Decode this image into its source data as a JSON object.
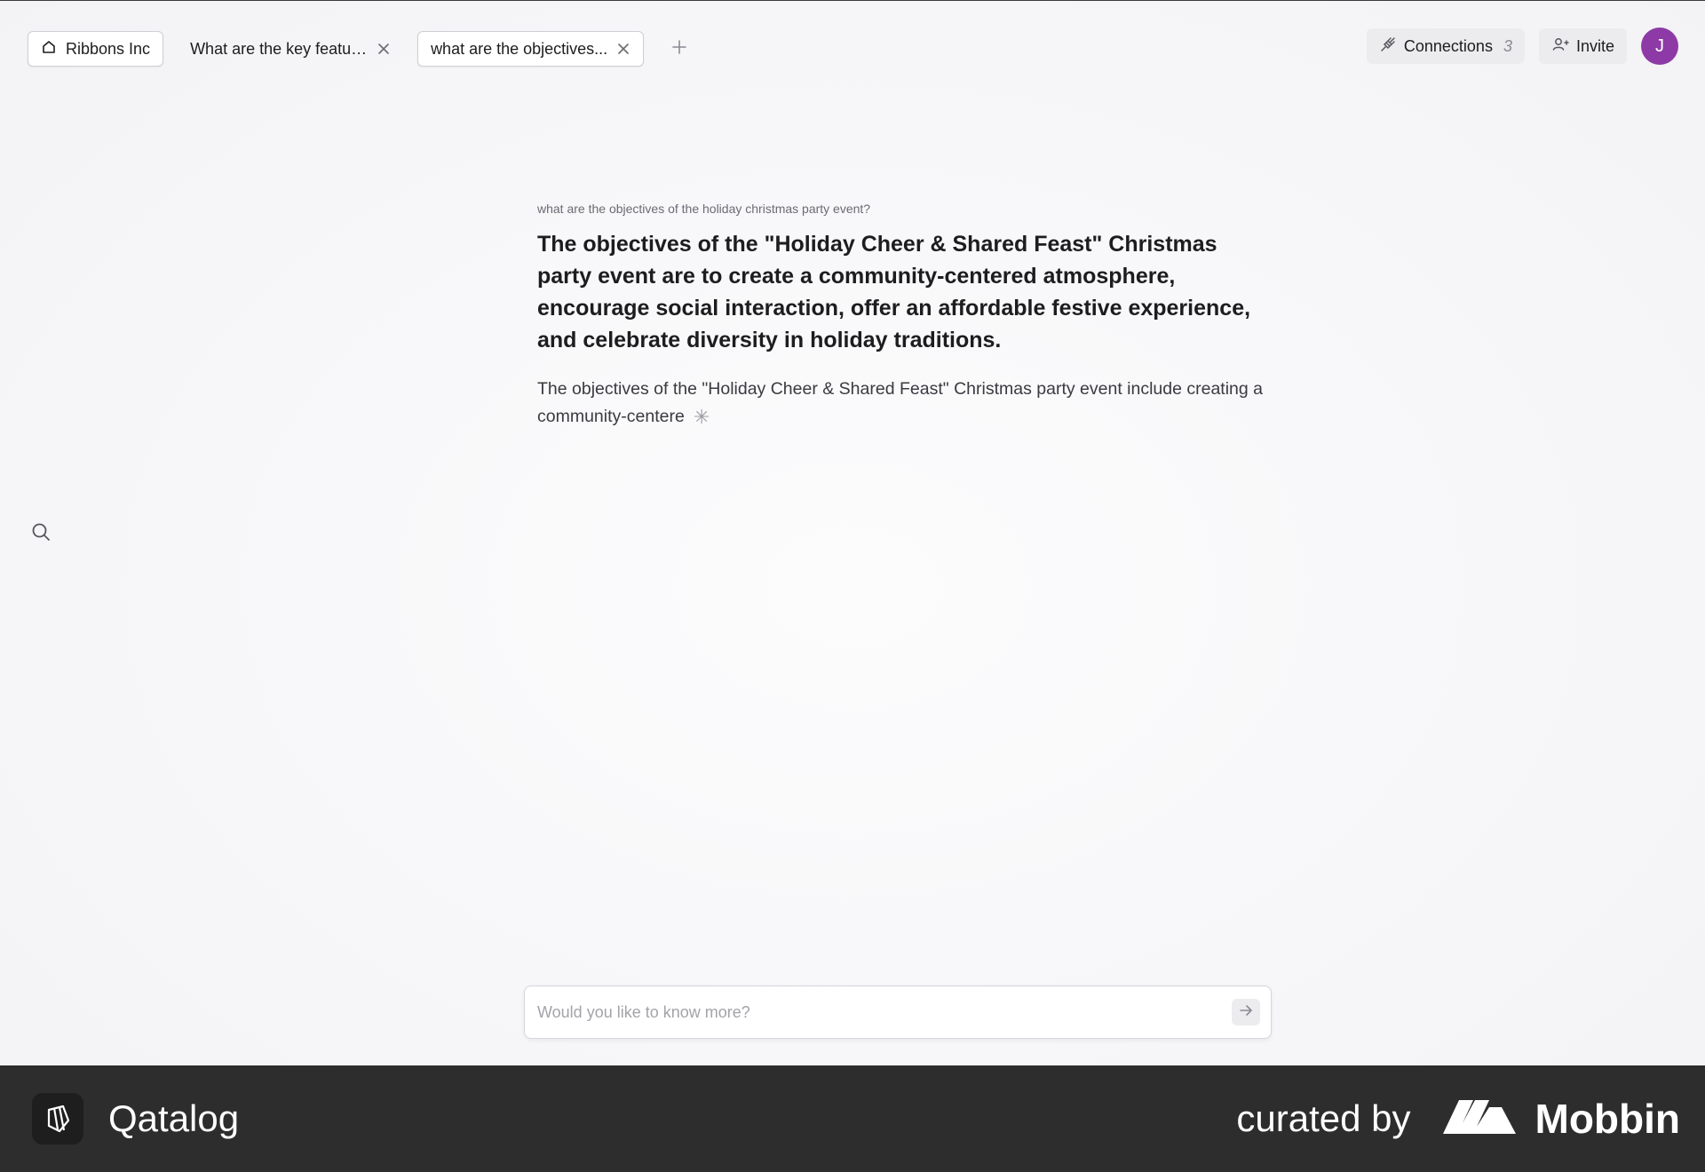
{
  "tabs": {
    "home": {
      "label": "Ribbons Inc",
      "icon": "home-icon"
    },
    "items": [
      {
        "label": "What are the key featur...",
        "close_icon": "close-icon"
      },
      {
        "label": "what are the objectives...",
        "close_icon": "close-icon"
      }
    ],
    "new_tab_icon": "plus-icon"
  },
  "header": {
    "connections": {
      "label": "Connections",
      "count": "3",
      "icon": "plug-icon"
    },
    "invite": {
      "label": "Invite",
      "icon": "add-user-icon"
    },
    "avatar_initial": "J",
    "avatar_color": "#8e3aa6"
  },
  "sidebar": {
    "search_icon": "search-icon"
  },
  "main": {
    "question": "what are the objectives of the holiday christmas party event?",
    "answer_heading": "The objectives of the \"Holiday Cheer & Shared Feast\" Christmas party event are to create a community-centered atmosphere, encourage social interaction, offer an affordable festive experience, and celebrate diversity in holiday traditions.",
    "answer_body": "The objectives of the \"Holiday Cheer & Shared Feast\" Christmas party event include creating a community-centere",
    "loading_glyph": "✳"
  },
  "ask": {
    "placeholder": "Would you like to know more?",
    "value": "",
    "send_icon": "arrow-right-icon"
  },
  "footer": {
    "app_name": "Qatalog",
    "curated_by": "curated by",
    "curator_name": "Mobbin",
    "background": "#2d2d2d"
  }
}
